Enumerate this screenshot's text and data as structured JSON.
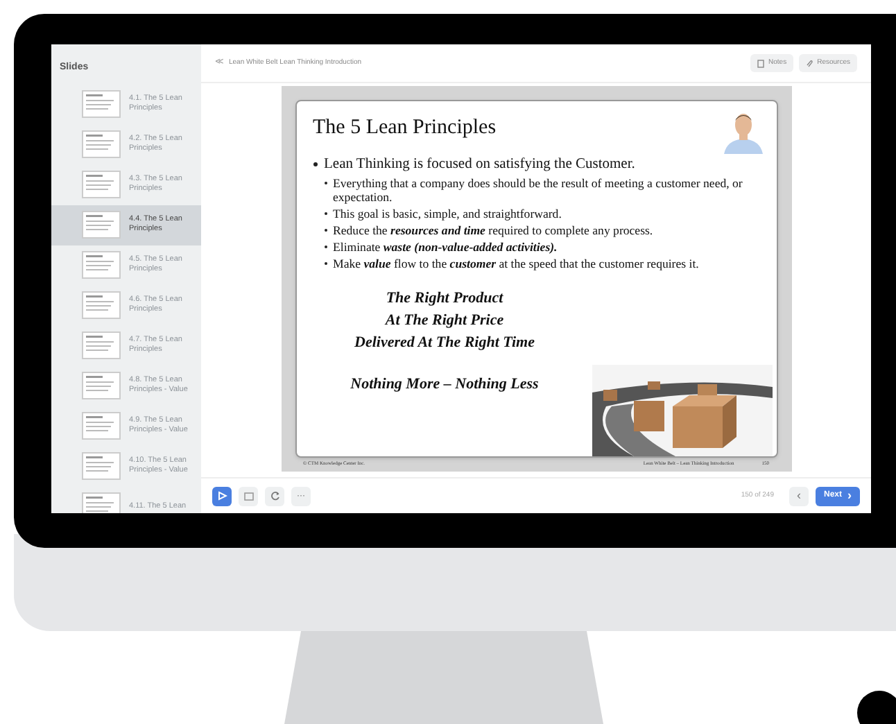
{
  "sidebar": {
    "title": "Slides",
    "items": [
      {
        "label": "4.1. The 5 Lean Principles",
        "selected": false
      },
      {
        "label": "4.2. The 5 Lean Principles",
        "selected": false
      },
      {
        "label": "4.3. The 5 Lean Principles",
        "selected": false
      },
      {
        "label": "4.4. The 5 Lean Principles",
        "selected": true
      },
      {
        "label": "4.5. The 5 Lean Principles",
        "selected": false
      },
      {
        "label": "4.6. The 5 Lean Principles",
        "selected": false
      },
      {
        "label": "4.7. The 5 Lean Principles",
        "selected": false
      },
      {
        "label": "4.8. The 5 Lean Principles - Value",
        "selected": false
      },
      {
        "label": "4.9. The 5 Lean Principles - Value",
        "selected": false
      },
      {
        "label": "4.10. The 5 Lean Principles - Value",
        "selected": false
      },
      {
        "label": "4.11. The 5 Lean",
        "selected": false
      }
    ]
  },
  "header": {
    "back": "≪",
    "title": "Lean White Belt Lean Thinking Introduction",
    "buttons": [
      "Notes",
      "Resources"
    ]
  },
  "slide": {
    "title": "The 5 Lean Principles",
    "bullets": [
      {
        "text": "Lean Thinking is focused on satisfying the Customer.",
        "children": [
          {
            "text": "Everything that a company does should be the result of meeting a customer need, or expectation."
          },
          {
            "text": "This goal is basic, simple, and straightforward."
          },
          {
            "text": "Reduce the **resources and time** required to complete any process."
          },
          {
            "text": "Eliminate **waste (non-value-added activities).**"
          },
          {
            "text": "Make **value** flow to the **customer** at the speed that the customer requires it."
          }
        ]
      }
    ],
    "tagline": [
      "The Right Product",
      "At The Right Price",
      "Delivered At The Right Time"
    ],
    "closing": "Nothing More – Nothing Less",
    "footer_left": "© CTM Knowledge Center Inc.",
    "footer_center": "Lean White Belt – Lean Thinking Introduction",
    "footer_page": "150"
  },
  "footer": {
    "counter": "150 of 249",
    "next": "Next",
    "next_arrow": "›",
    "prev": "‹",
    "more": "···"
  }
}
